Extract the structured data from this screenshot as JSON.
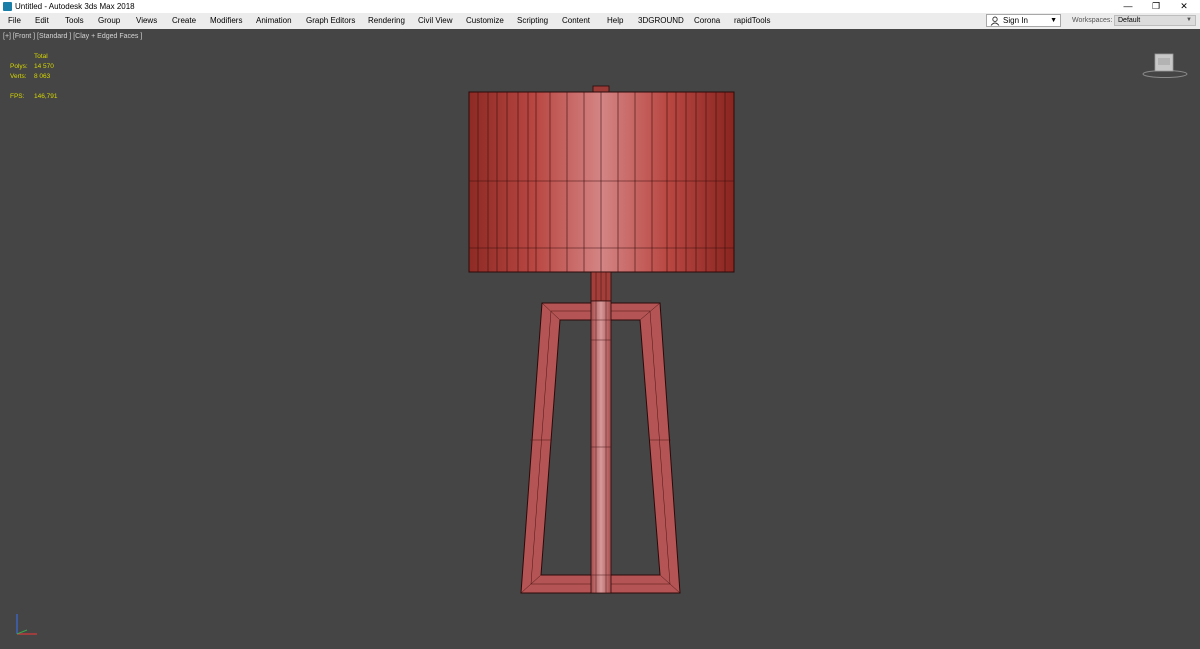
{
  "window": {
    "title": "Untitled - Autodesk 3ds Max 2018",
    "minimize": "—",
    "restore": "❐",
    "close": "✕"
  },
  "menu": [
    "File",
    "Edit",
    "Tools",
    "Group",
    "Views",
    "Create",
    "Modifiers",
    "Animation",
    "Graph Editors",
    "Rendering",
    "Civil View",
    "Customize",
    "Scripting",
    "Content",
    "Help",
    "3DGROUND",
    "Corona",
    "rapidTools"
  ],
  "signin": {
    "label": "Sign In"
  },
  "workspaces": {
    "label": "Workspaces:",
    "value": "Default"
  },
  "viewport": {
    "label": "[+] [Front ] [Standard ] [Clay + Edged Faces ]",
    "stats": {
      "total_label": "Total",
      "polys_label": "Polys:",
      "polys_value": "14 570",
      "verts_label": "Verts:",
      "verts_value": "8 063",
      "fps_label": "FPS:",
      "fps_value": "146,791"
    }
  },
  "colors": {
    "viewport_bg": "#454545",
    "stats_text": "#d8d800",
    "model_red": "#b84848"
  },
  "icons": [
    "app-icon",
    "user-icon",
    "chevron-down-icon",
    "viewcube-icon",
    "axis-tripod-icon",
    "minimize-icon",
    "restore-icon",
    "close-icon"
  ]
}
